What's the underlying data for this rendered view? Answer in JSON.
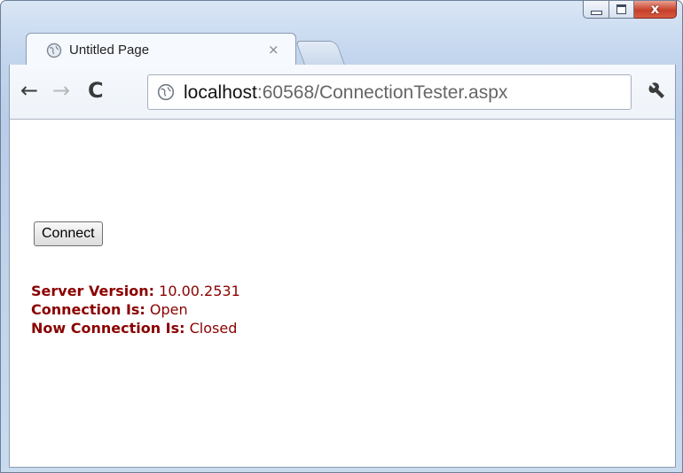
{
  "window": {
    "controls": {
      "minimize": "minimize",
      "maximize": "maximize",
      "close": "x"
    }
  },
  "tab": {
    "title": "Untitled Page",
    "close": "×"
  },
  "toolbar": {
    "back": "←",
    "forward": "→",
    "reload": "C",
    "url_host": "localhost",
    "url_rest": ":60568/ConnectionTester.aspx",
    "wrench_icon": "wrench-icon"
  },
  "page": {
    "connect_button": "Connect",
    "server_version_label": "Server Version:",
    "server_version_value": " 10.00.2531",
    "connection_is_label": "Connection Is:",
    "connection_is_value": " Open",
    "now_connection_is_label": "Now Connection Is:",
    "now_connection_is_value": " Closed"
  },
  "colors": {
    "info_text": "#8b0000",
    "close_button": "#c7402a"
  }
}
